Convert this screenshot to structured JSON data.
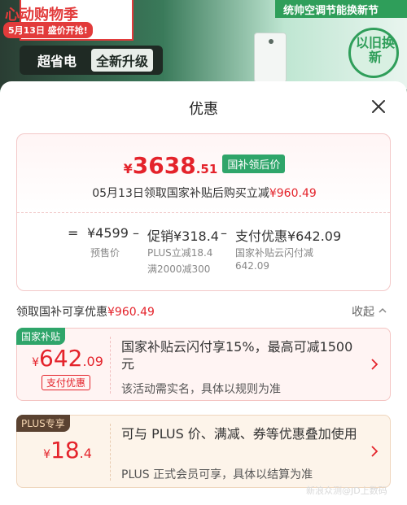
{
  "banner": {
    "promo_title": "心动购物季",
    "promo_date": "5月13日 盛价开抢!",
    "tag_energy": "超省电",
    "tag_upgrade": "全新升级",
    "green_strip": "统帅空调节能换新节",
    "badge_text": "以旧换新"
  },
  "sheet": {
    "title": "优惠"
  },
  "summary": {
    "price_symbol": "¥",
    "price_int": "3638",
    "price_dec": ".51",
    "price_tag": "国补领后价",
    "subtitle_prefix": "05月13日领取国家补贴后购买立减",
    "subtitle_amount": "¥960.49",
    "calc": {
      "eq": "=",
      "presale_value": "¥4599",
      "presale_label": "预售价",
      "minus1": "–",
      "promo_value": "促销¥318.4",
      "promo_line1": "PLUS立减18.4",
      "promo_line2": "满2000减300",
      "minus2": "–",
      "pay_value": "支付优惠¥642.09",
      "pay_line1": "国家补贴云闪付减",
      "pay_line2": "642.09"
    }
  },
  "section": {
    "header_prefix": "领取国补可享优惠",
    "header_amount": "¥960.49",
    "collapse_label": "收起"
  },
  "offers": [
    {
      "label": "国家补贴",
      "symbol": "¥",
      "int": "642",
      "dec": ".09",
      "chip": "支付优惠",
      "main": "国家补贴云闪付享15%，最高可减1500元",
      "note": "该活动需实名，具体以规则为准"
    },
    {
      "label": "PLUS专享",
      "symbol": "¥",
      "int": "18",
      "dec": ".4",
      "main": "可与 PLUS 价、满减、券等优惠叠加使用",
      "note": "PLUS 正式会员可享，具体以结算为准"
    }
  ],
  "watermark": "新浪众测@JD上数码",
  "colors": {
    "accent_red": "#e4232b",
    "subsidy_green": "#2fa56a",
    "plus_brown": "#5a4231"
  }
}
